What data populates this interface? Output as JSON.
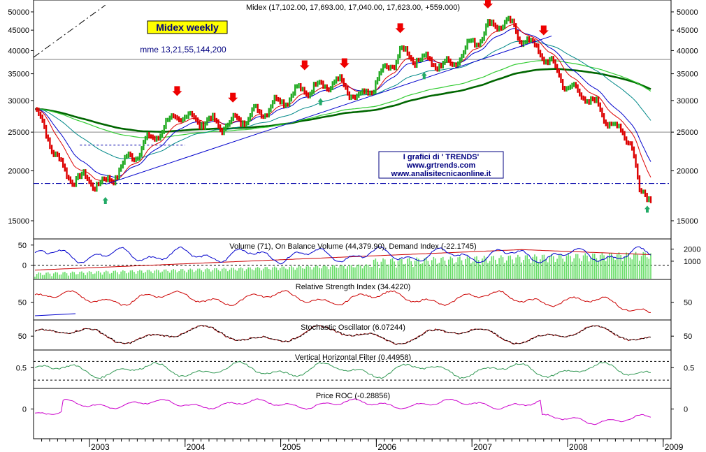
{
  "chart_data": [
    {
      "type": "line",
      "title": "Midex (17,102.00, 17,693.00, 17,040.00, 17,623.00, +559.000)",
      "badge": "Midex weekly",
      "subtitle": "mme 13,21,55,144,200",
      "watermark": [
        "I grafici di ' TRENDS'",
        "www.grtrends.com",
        "www.analisitecnicaonline.it"
      ],
      "yticks": [
        15000,
        20000,
        25000,
        30000,
        35000,
        40000,
        45000,
        50000
      ],
      "ylim": [
        12000,
        52000
      ],
      "log_scale": true,
      "horizontal_levels": [
        25000,
        38000
      ],
      "support_level": 18600,
      "x": [
        "2002-06",
        "2002-10",
        "2003-03",
        "2003-06",
        "2003-12",
        "2004-06",
        "2004-11",
        "2005-03",
        "2005-08",
        "2005-11",
        "2006-04",
        "2006-10",
        "2007-03",
        "2007-05",
        "2007-08",
        "2007-10",
        "2008-01",
        "2008-04",
        "2008-07",
        "2008-09",
        "2008-10",
        "2008-11"
      ],
      "series": [
        {
          "name": "Midex",
          "color": "#22aa22",
          "values": [
            29000,
            19500,
            18500,
            21500,
            27500,
            26000,
            28500,
            31500,
            33500,
            30000,
            39500,
            36500,
            45500,
            47500,
            42000,
            39000,
            32500,
            30000,
            25500,
            24000,
            17500,
            17600
          ]
        }
      ],
      "trendlines": [
        {
          "color": "#0000cc",
          "points": [
            [
              "2003-03",
              18500
            ],
            [
              "2007-11",
              43500
            ]
          ]
        },
        {
          "color": "#000000",
          "dash": true,
          "points": [
            [
              "2002-06",
              38500
            ],
            [
              "2003-03",
              52000
            ]
          ]
        }
      ],
      "sell_arrows": [
        "2003-12",
        "2004-07",
        "2005-04",
        "2005-09",
        "2006-04",
        "2007-03",
        "2007-10"
      ],
      "buy_arrows": [
        "2003-03",
        "2005-06",
        "2006-07",
        "2008-11"
      ],
      "xlabels": [
        "2003",
        "2004",
        "2005",
        "2006",
        "2007",
        "2008",
        "2009"
      ]
    },
    {
      "type": "line",
      "title": "Volume (71), On Balance Volume (44,379.90), Demand Index (-22.1745)",
      "yticks_left": [
        0,
        50
      ],
      "yticks_right": [
        1000,
        2000
      ]
    },
    {
      "type": "line",
      "title": "Relative Strength Index (34.4220)",
      "yticks": [
        50
      ]
    },
    {
      "type": "line",
      "title": "Stochastic Oscillator (6.07244)",
      "yticks": [
        50
      ]
    },
    {
      "type": "line",
      "title": "Vertical Horizontal Filter (0.44958)",
      "yticks": [
        0.5
      ]
    },
    {
      "type": "line",
      "title": "Price ROC (-0.28856)",
      "yticks": [
        0
      ]
    }
  ],
  "colors": {
    "price_up": "#22aa22",
    "price_down": "#dd0000",
    "ema13": "#dd0000",
    "ema21": "#0000cc",
    "ema55": "#008888",
    "ema144": "#33cc33",
    "ema200": "#006600",
    "volume": "#66dd66",
    "obv": "#0000cc",
    "demand": "#cc0000",
    "rsi": "#cc0000",
    "stoch": "#990000",
    "vhf": "#339955",
    "roc": "#cc00cc",
    "badge_bg": "#ffff00",
    "badge_text": "#000080",
    "watermark_text": "#000080"
  }
}
